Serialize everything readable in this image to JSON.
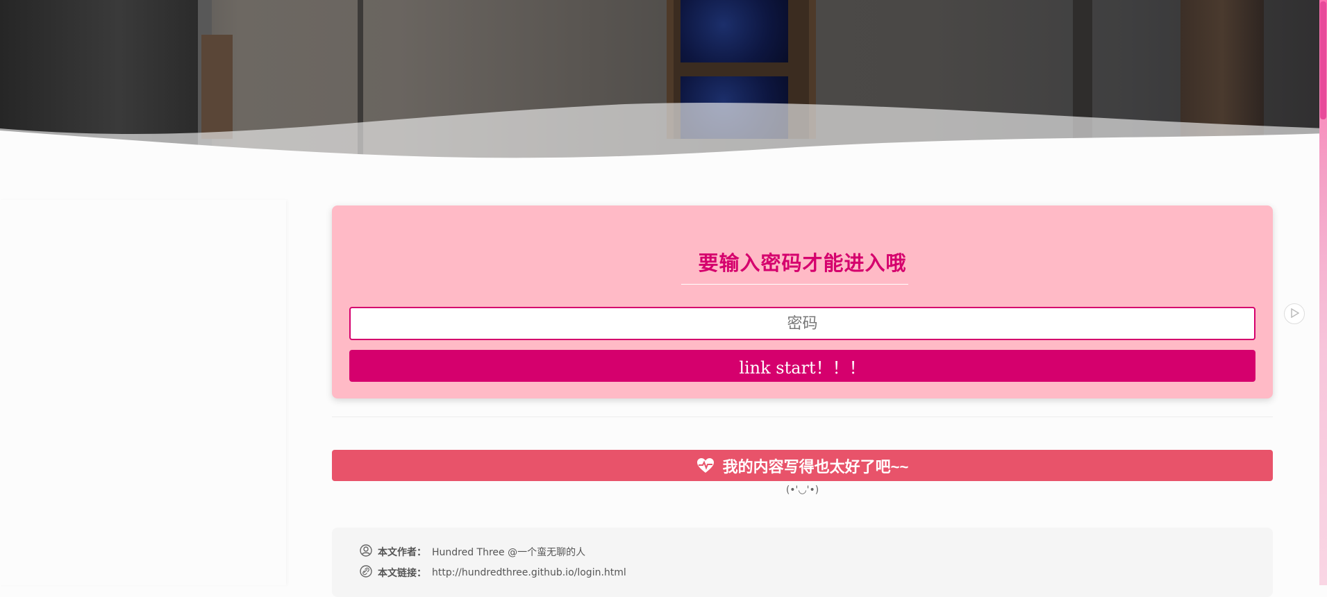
{
  "colors": {
    "accent": "#d5006d",
    "card_bg": "#ffbac6",
    "praise_bg": "#e8536a",
    "scroll_accent": "#ff6fb0"
  },
  "lock": {
    "title": "要输入密码才能进入哦",
    "password_placeholder": "密码",
    "password_value": "",
    "submit_label": "link start！！！"
  },
  "praise": {
    "icon": "heartbeat-icon",
    "label": "我的内容写得也太好了吧~~",
    "kaomoji": "(•'◡'•)"
  },
  "copyright": {
    "author_icon": "user-circle-icon",
    "author_label": "本文作者：",
    "author_value": "Hundred Three @一个蛮无聊的人",
    "link_icon": "link-icon",
    "link_label": "本文链接：",
    "link_value": "http://hundredthree.github.io/login.html"
  },
  "widgets": {
    "next_icon": "play-arrow-icon"
  }
}
